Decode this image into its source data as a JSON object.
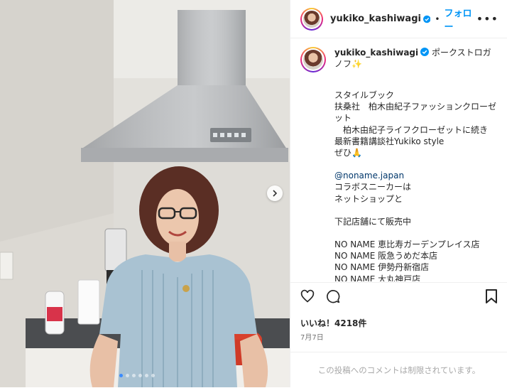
{
  "post": {
    "username": "yukiko_kashiwagi",
    "follow_label": "フォロー",
    "separator": "•",
    "more_label": "•••",
    "caption_first": "ポークストロガノフ✨",
    "caption_lines": [
      "",
      "スタイルブック",
      "扶桑社　柏木由紀子ファッションクローゼット",
      "　柏木由紀子ライフクローゼットに続き",
      "最新書籍講談社Yukiko style",
      "ぜひ🙏",
      "",
      "@noname.japan",
      "コラボスニーカーは",
      "ネットショップと",
      "",
      "下記店舗にて販売中",
      "",
      "NO NAME 恵比寿ガーデンプレイス店",
      "NO NAME 阪急うめだ本店",
      "NO NAME 伊勢丹新宿店",
      "NO NAME 大丸神戸店"
    ],
    "likes_label": "いいね！4218件",
    "date": "7月7日",
    "comments_disabled": "この投稿へのコメントは制限されています。"
  },
  "carousel": {
    "dot_count": 6,
    "active_index": 0
  },
  "colors": {
    "accent": "#0095f6",
    "verified": "#0095f6",
    "mention": "#00376b"
  },
  "icons": [
    "verified-icon",
    "more-icon",
    "heart-icon",
    "comment-icon",
    "bookmark-icon",
    "chevron-right-icon"
  ]
}
